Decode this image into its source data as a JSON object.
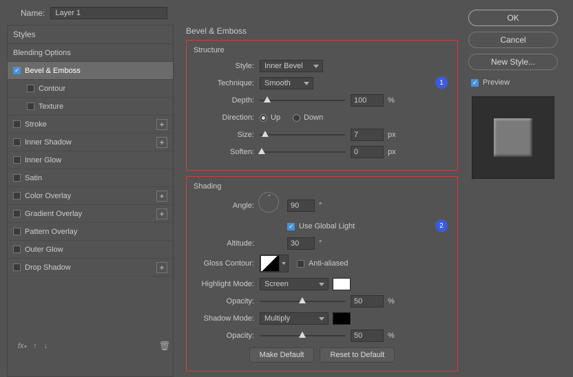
{
  "name_label": "Name:",
  "name_value": "Layer 1",
  "left": {
    "styles_header": "Styles",
    "blending": "Blending Options",
    "bevel": "Bevel & Emboss",
    "contour": "Contour",
    "texture": "Texture",
    "stroke": "Stroke",
    "inner_shadow": "Inner Shadow",
    "inner_glow": "Inner Glow",
    "satin": "Satin",
    "color_overlay": "Color Overlay",
    "gradient_overlay": "Gradient Overlay",
    "pattern_overlay": "Pattern Overlay",
    "outer_glow": "Outer Glow",
    "drop_shadow": "Drop Shadow"
  },
  "mid": {
    "title": "Bevel & Emboss",
    "structure_head": "Structure",
    "style_lbl": "Style:",
    "style_val": "Inner Bevel",
    "technique_lbl": "Technique:",
    "technique_val": "Smooth",
    "depth_lbl": "Depth:",
    "depth_val": "100",
    "depth_unit": "%",
    "direction_lbl": "Direction:",
    "dir_up": "Up",
    "dir_down": "Down",
    "size_lbl": "Size:",
    "size_val": "7",
    "size_unit": "px",
    "soften_lbl": "Soften:",
    "soften_val": "0",
    "soften_unit": "px",
    "badge1": "1",
    "shading_head": "Shading",
    "angle_lbl": "Angle:",
    "angle_val": "90",
    "deg": "°",
    "global": "Use Global Light",
    "altitude_lbl": "Altitude:",
    "altitude_val": "30",
    "gloss_lbl": "Gloss Contour:",
    "anti": "Anti-aliased",
    "badge2": "2",
    "hlmode_lbl": "Highlight Mode:",
    "hlmode_val": "Screen",
    "opacity_lbl": "Opacity:",
    "hl_opacity": "50",
    "shmode_lbl": "Shadow Mode:",
    "shmode_val": "Multiply",
    "sh_opacity": "50",
    "pct": "%",
    "make_default": "Make Default",
    "reset_default": "Reset to Default"
  },
  "right": {
    "ok": "OK",
    "cancel": "Cancel",
    "new_style": "New Style...",
    "preview": "Preview"
  }
}
